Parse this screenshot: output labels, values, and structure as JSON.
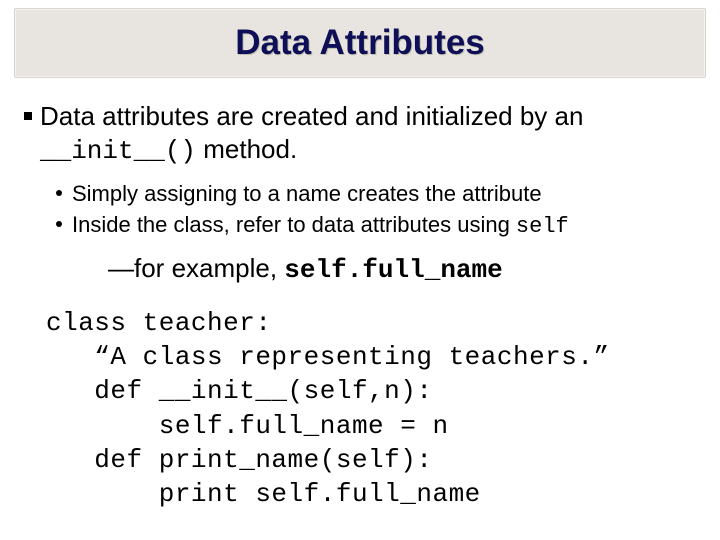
{
  "title": "Data Attributes",
  "top_bullet": {
    "prefix": "Data attributes are created and initialized by an ",
    "code": "__init__()",
    "suffix": " method."
  },
  "sub_bullets": [
    {
      "text": "Simply assigning to a name creates the attribute"
    },
    {
      "prefix": "Inside the class, refer to data attributes using ",
      "code": "self"
    }
  ],
  "example": {
    "dash": "—",
    "prefix": "for example, ",
    "code": "self.full_name"
  },
  "code_lines": [
    "class teacher:",
    "   “A class representing teachers.”",
    "   def __init__(self,n):",
    "       self.full_name = n",
    "   def print_name(self):",
    "       print self.full_name"
  ]
}
